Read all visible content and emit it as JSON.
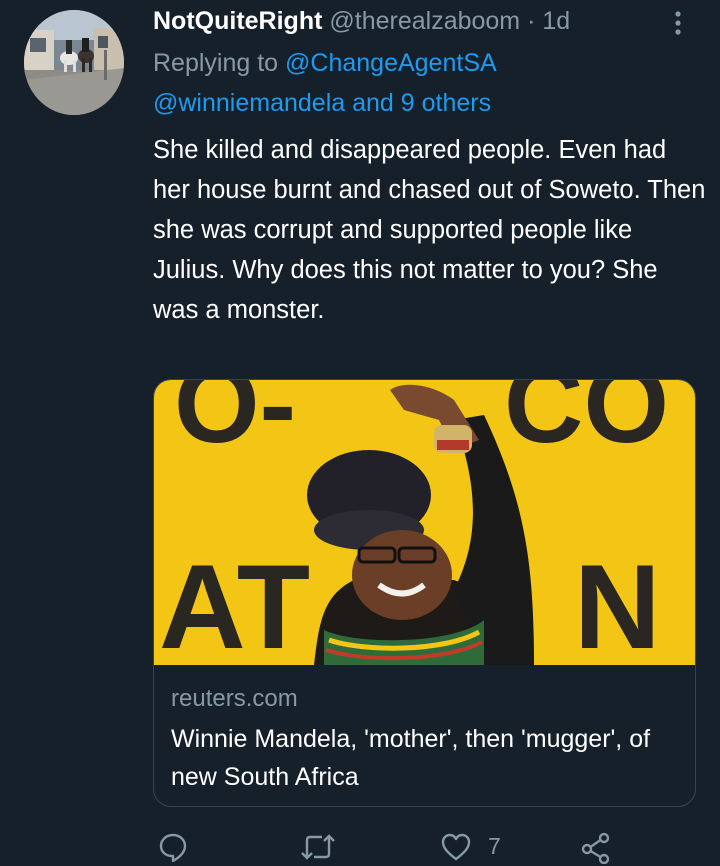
{
  "tweet": {
    "display_name": "NotQuiteRight",
    "handle": "@therealzaboom",
    "separator": "·",
    "time": "1d",
    "replying_to_prefix": "Replying to ",
    "replying_to_user": "@ChangeAgentSA",
    "replying_to_line2": "@winniemandela and 9 others",
    "text": "She killed and disappeared people. Even had her house burnt and chased out of Soweto. Then she was corrupt and supported people like Julius. Why does this not matter to you? She was a monster."
  },
  "card": {
    "domain": "reuters.com",
    "title": "Winnie Mandela, 'mother', then 'mugger', of new South Africa",
    "image_banner_text": [
      "O-",
      "CO",
      "AT",
      "N"
    ]
  },
  "actions": {
    "reply_icon": "reply-icon",
    "retweet_icon": "retweet-icon",
    "like_icon": "heart-icon",
    "like_count": "7",
    "share_icon": "share-icon"
  },
  "colors": {
    "background": "#15202b",
    "link": "#1d9bf0",
    "muted": "#8899a6",
    "border": "#38444d",
    "banner_yellow": "#f3c515"
  }
}
